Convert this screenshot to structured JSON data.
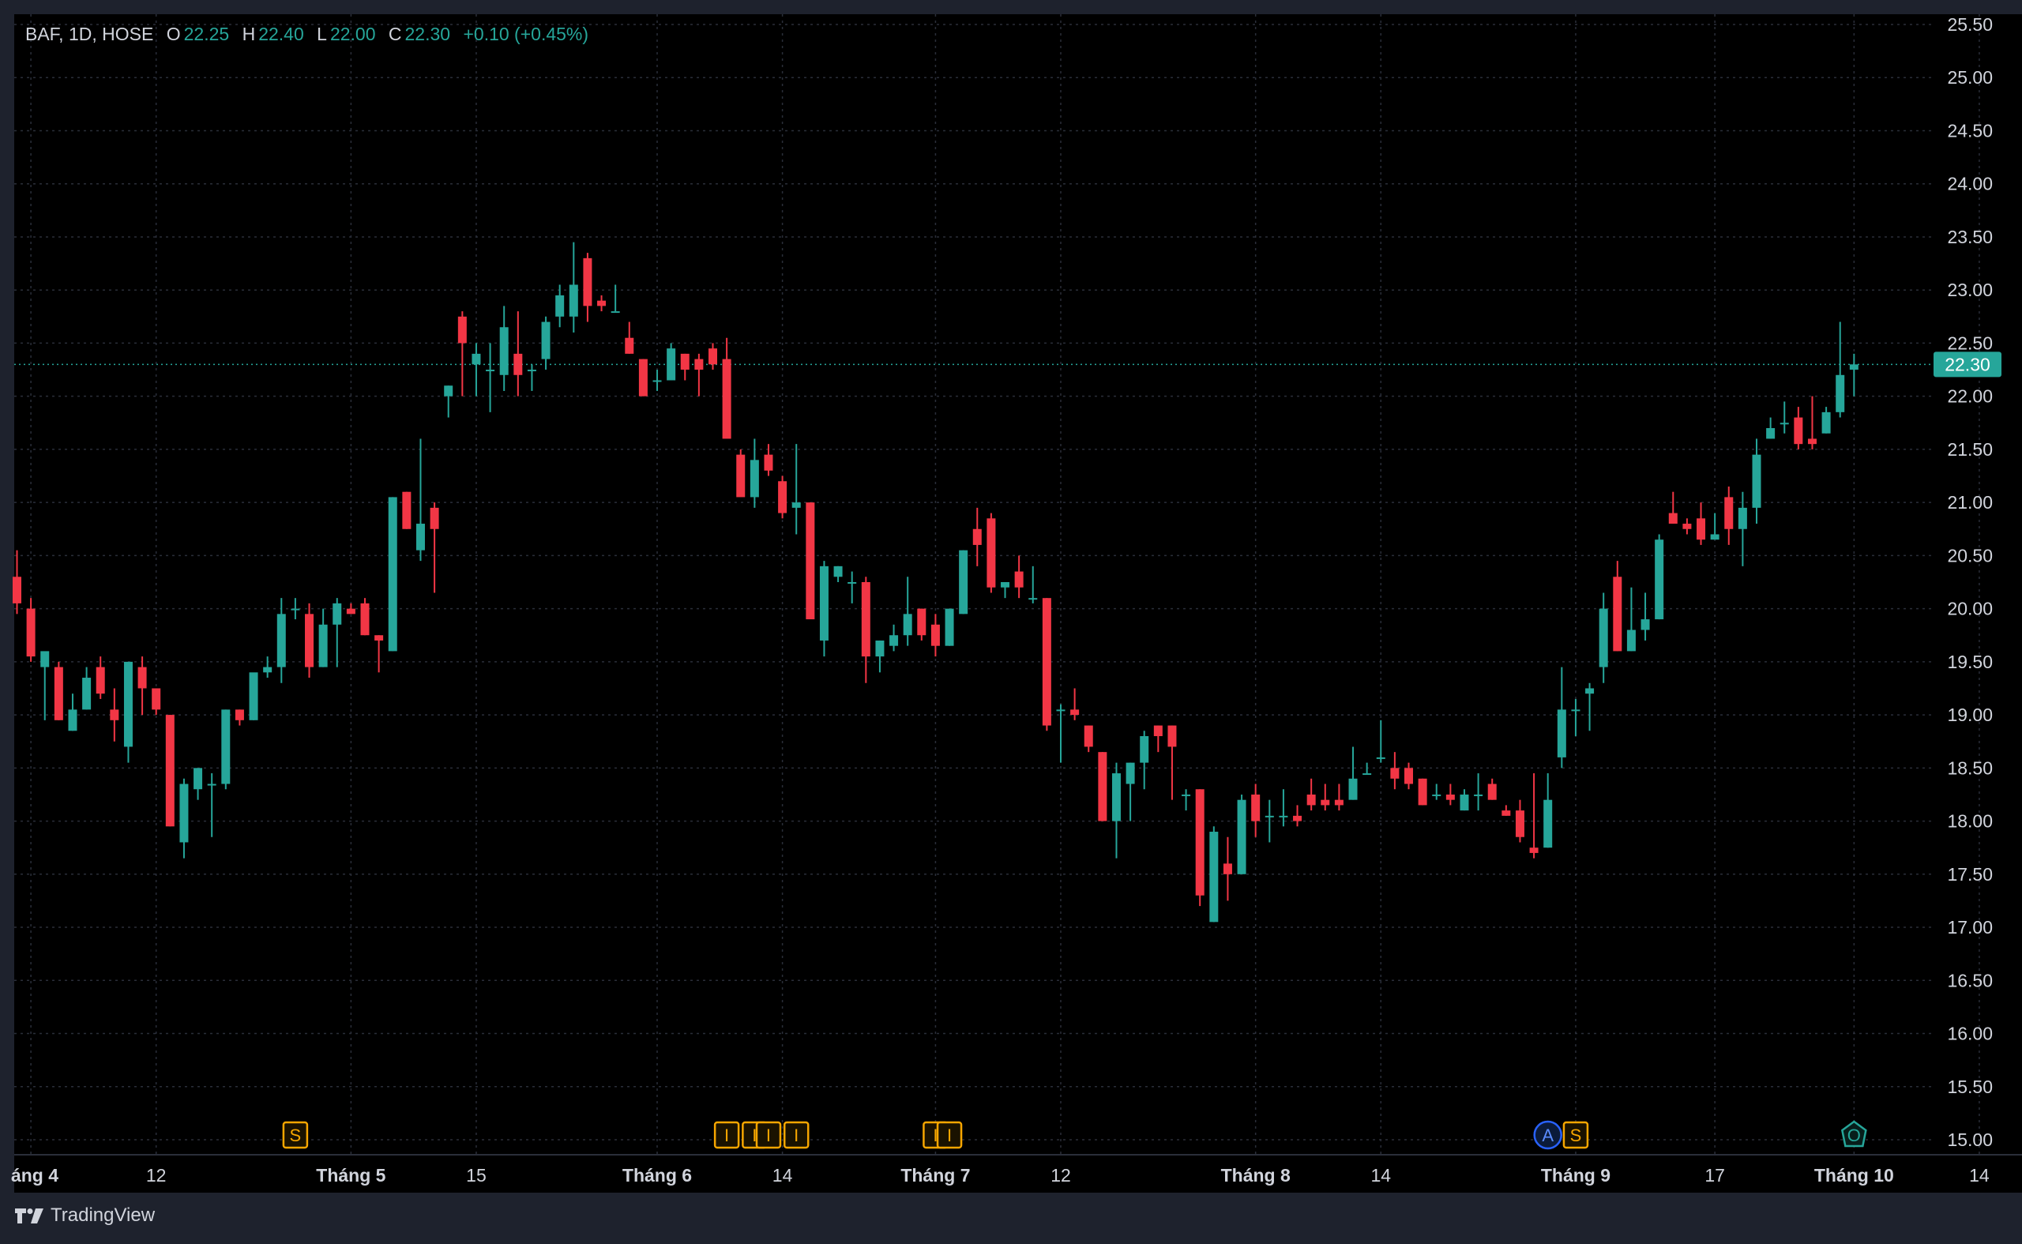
{
  "legend": {
    "symbol": "BAF, 1D, HOSE",
    "open_label": "O",
    "open": "22.25",
    "high_label": "H",
    "high": "22.40",
    "low_label": "L",
    "low": "22.00",
    "close_label": "C",
    "close": "22.30",
    "change": "+0.10 (+0.45%)"
  },
  "branding": {
    "name": "TradingView"
  },
  "colors": {
    "up": "#26a69a",
    "down": "#f23645",
    "marker": "#f7a600",
    "dividend": "#2962ff",
    "earnings": "#26a69a"
  },
  "markers": [
    {
      "label": "S",
      "type": "split",
      "date": "2024-04-26"
    },
    {
      "label": "I",
      "type": "ipo-event",
      "date": "2024-06-10"
    },
    {
      "label": "I",
      "type": "ipo-event",
      "date": "2024-06-12"
    },
    {
      "label": "I",
      "type": "ipo-event",
      "date": "2024-06-13"
    },
    {
      "label": "I",
      "type": "ipo-event",
      "date": "2024-06-17"
    },
    {
      "label": "I",
      "type": "ipo-event",
      "date": "2024-07-01"
    },
    {
      "label": "I",
      "type": "ipo-event",
      "date": "2024-07-02"
    },
    {
      "label": "A",
      "type": "dividend",
      "date": "2024-08-30"
    },
    {
      "label": "S",
      "type": "split",
      "date": "2024-09-03"
    },
    {
      "label": "O",
      "type": "earnings",
      "date": "2024-10-01"
    }
  ],
  "chart_data": {
    "type": "candlestick",
    "symbol": "BAF",
    "interval": "1D",
    "exchange": "HOSE",
    "y_range": [
      15.0,
      25.5
    ],
    "y_ticks": [
      "15.00",
      "15.50",
      "16.00",
      "16.50",
      "17.00",
      "17.50",
      "18.00",
      "18.50",
      "19.00",
      "19.50",
      "20.00",
      "20.50",
      "21.00",
      "21.50",
      "22.00",
      "22.50",
      "23.00",
      "23.50",
      "24.00",
      "24.50",
      "25.00",
      "25.50"
    ],
    "last_price": "22.30",
    "x_ticks": [
      {
        "label": "áng 4",
        "date": "2024-04-01"
      },
      {
        "label": "12",
        "date": "2024-04-12"
      },
      {
        "label": "Tháng 5",
        "date": "2024-05-02"
      },
      {
        "label": "15",
        "date": "2024-05-15"
      },
      {
        "label": "Tháng 6",
        "date": "2024-06-03"
      },
      {
        "label": "14",
        "date": "2024-06-14"
      },
      {
        "label": "Tháng 7",
        "date": "2024-07-01"
      },
      {
        "label": "12",
        "date": "2024-07-12"
      },
      {
        "label": "Tháng 8",
        "date": "2024-08-01"
      },
      {
        "label": "14",
        "date": "2024-08-14"
      },
      {
        "label": "Tháng 9",
        "date": "2024-09-03"
      },
      {
        "label": "17",
        "date": "2024-09-17"
      },
      {
        "label": "Tháng 10",
        "date": "2024-10-01"
      },
      {
        "label": "14",
        "date": "2024-10-14"
      }
    ],
    "grid": true,
    "candles": [
      {
        "o": 20.3,
        "h": 20.55,
        "l": 19.95,
        "c": 20.05
      },
      {
        "o": 20.0,
        "h": 20.1,
        "l": 19.5,
        "c": 19.55
      },
      {
        "o": 19.45,
        "h": 19.55,
        "l": 18.95,
        "c": 19.6
      },
      {
        "o": 19.45,
        "h": 19.5,
        "l": 18.95,
        "c": 18.95
      },
      {
        "o": 18.85,
        "h": 19.2,
        "l": 18.85,
        "c": 19.05
      },
      {
        "o": 19.05,
        "h": 19.45,
        "l": 19.05,
        "c": 19.35
      },
      {
        "o": 19.45,
        "h": 19.55,
        "l": 19.15,
        "c": 19.2
      },
      {
        "o": 19.05,
        "h": 19.25,
        "l": 18.75,
        "c": 18.95
      },
      {
        "o": 18.7,
        "h": 19.5,
        "l": 18.55,
        "c": 19.5
      },
      {
        "o": 19.45,
        "h": 19.55,
        "l": 19.0,
        "c": 19.25
      },
      {
        "o": 19.25,
        "h": 19.25,
        "l": 19.0,
        "c": 19.05
      },
      {
        "o": 19.0,
        "h": 19.0,
        "l": 17.95,
        "c": 17.95
      },
      {
        "o": 17.8,
        "h": 18.4,
        "l": 17.65,
        "c": 18.35
      },
      {
        "o": 18.3,
        "h": 18.5,
        "l": 18.2,
        "c": 18.5
      },
      {
        "o": 18.35,
        "h": 18.45,
        "l": 17.85,
        "c": 18.35
      },
      {
        "o": 18.35,
        "h": 19.05,
        "l": 18.3,
        "c": 19.05
      },
      {
        "o": 19.05,
        "h": 19.05,
        "l": 18.9,
        "c": 18.95
      },
      {
        "o": 18.95,
        "h": 19.35,
        "l": 18.95,
        "c": 19.4
      },
      {
        "o": 19.4,
        "h": 19.55,
        "l": 19.35,
        "c": 19.45
      },
      {
        "o": 19.45,
        "h": 20.1,
        "l": 19.3,
        "c": 19.95
      },
      {
        "o": 20.0,
        "h": 20.1,
        "l": 19.9,
        "c": 20.0
      },
      {
        "o": 19.95,
        "h": 20.05,
        "l": 19.35,
        "c": 19.45
      },
      {
        "o": 19.45,
        "h": 20.0,
        "l": 19.45,
        "c": 19.85
      },
      {
        "o": 19.85,
        "h": 20.1,
        "l": 19.45,
        "c": 20.05
      },
      {
        "o": 20.0,
        "h": 20.05,
        "l": 19.95,
        "c": 19.95
      },
      {
        "o": 20.05,
        "h": 20.1,
        "l": 19.75,
        "c": 19.75
      },
      {
        "o": 19.75,
        "h": 19.75,
        "l": 19.4,
        "c": 19.7
      },
      {
        "o": 19.6,
        "h": 21.05,
        "l": 19.6,
        "c": 21.05
      },
      {
        "o": 21.1,
        "h": 21.1,
        "l": 20.75,
        "c": 20.75
      },
      {
        "o": 20.55,
        "h": 21.6,
        "l": 20.45,
        "c": 20.8
      },
      {
        "o": 20.95,
        "h": 21.0,
        "l": 20.15,
        "c": 20.75
      },
      {
        "o": 22.0,
        "h": 22.1,
        "l": 21.8,
        "c": 22.1
      },
      {
        "o": 22.75,
        "h": 22.8,
        "l": 22.0,
        "c": 22.5
      },
      {
        "o": 22.3,
        "h": 22.5,
        "l": 22.0,
        "c": 22.4
      },
      {
        "o": 22.25,
        "h": 22.5,
        "l": 21.85,
        "c": 22.25
      },
      {
        "o": 22.2,
        "h": 22.85,
        "l": 22.05,
        "c": 22.65
      },
      {
        "o": 22.4,
        "h": 22.8,
        "l": 22.0,
        "c": 22.2
      },
      {
        "o": 22.25,
        "h": 22.3,
        "l": 22.05,
        "c": 22.25
      },
      {
        "o": 22.35,
        "h": 22.75,
        "l": 22.25,
        "c": 22.7
      },
      {
        "o": 22.75,
        "h": 23.05,
        "l": 22.65,
        "c": 22.95
      },
      {
        "o": 22.75,
        "h": 23.45,
        "l": 22.6,
        "c": 23.05
      },
      {
        "o": 23.3,
        "h": 23.35,
        "l": 22.7,
        "c": 22.85
      },
      {
        "o": 22.9,
        "h": 22.95,
        "l": 22.8,
        "c": 22.85
      },
      {
        "o": 22.8,
        "h": 23.05,
        "l": 22.8,
        "c": 22.8
      },
      {
        "o": 22.55,
        "h": 22.7,
        "l": 22.4,
        "c": 22.4
      },
      {
        "o": 22.35,
        "h": 22.35,
        "l": 22.0,
        "c": 22.0
      },
      {
        "o": 22.15,
        "h": 22.25,
        "l": 22.05,
        "c": 22.15
      },
      {
        "o": 22.15,
        "h": 22.5,
        "l": 22.15,
        "c": 22.45
      },
      {
        "o": 22.4,
        "h": 22.4,
        "l": 22.15,
        "c": 22.25
      },
      {
        "o": 22.35,
        "h": 22.4,
        "l": 22.0,
        "c": 22.25
      },
      {
        "o": 22.45,
        "h": 22.5,
        "l": 22.25,
        "c": 22.3
      },
      {
        "o": 22.35,
        "h": 22.55,
        "l": 21.75,
        "c": 21.6
      },
      {
        "o": 21.45,
        "h": 21.5,
        "l": 21.1,
        "c": 21.05
      },
      {
        "o": 21.05,
        "h": 21.6,
        "l": 20.95,
        "c": 21.4
      },
      {
        "o": 21.45,
        "h": 21.55,
        "l": 21.25,
        "c": 21.3
      },
      {
        "o": 21.2,
        "h": 21.25,
        "l": 20.85,
        "c": 20.9
      },
      {
        "o": 20.95,
        "h": 21.55,
        "l": 20.7,
        "c": 21.0
      },
      {
        "o": 21.0,
        "h": 21.0,
        "l": 19.95,
        "c": 19.9
      },
      {
        "o": 19.7,
        "h": 20.45,
        "l": 19.55,
        "c": 20.4
      },
      {
        "o": 20.3,
        "h": 20.4,
        "l": 20.25,
        "c": 20.4
      },
      {
        "o": 20.25,
        "h": 20.35,
        "l": 20.05,
        "c": 20.25
      },
      {
        "o": 20.25,
        "h": 20.3,
        "l": 19.3,
        "c": 19.55
      },
      {
        "o": 19.55,
        "h": 19.7,
        "l": 19.4,
        "c": 19.7
      },
      {
        "o": 19.65,
        "h": 19.85,
        "l": 19.6,
        "c": 19.75
      },
      {
        "o": 19.75,
        "h": 20.3,
        "l": 19.65,
        "c": 19.95
      },
      {
        "o": 20.0,
        "h": 20.0,
        "l": 19.7,
        "c": 19.75
      },
      {
        "o": 19.85,
        "h": 19.95,
        "l": 19.55,
        "c": 19.65
      },
      {
        "o": 19.65,
        "h": 20.0,
        "l": 19.65,
        "c": 20.0
      },
      {
        "o": 19.95,
        "h": 20.55,
        "l": 19.95,
        "c": 20.55
      },
      {
        "o": 20.75,
        "h": 20.95,
        "l": 20.4,
        "c": 20.6
      },
      {
        "o": 20.85,
        "h": 20.9,
        "l": 20.15,
        "c": 20.2
      },
      {
        "o": 20.2,
        "h": 20.25,
        "l": 20.1,
        "c": 20.25
      },
      {
        "o": 20.35,
        "h": 20.5,
        "l": 20.1,
        "c": 20.2
      },
      {
        "o": 20.1,
        "h": 20.4,
        "l": 20.05,
        "c": 20.1
      },
      {
        "o": 20.1,
        "h": 20.1,
        "l": 18.85,
        "c": 18.9
      },
      {
        "o": 19.05,
        "h": 19.1,
        "l": 18.55,
        "c": 19.05
      },
      {
        "o": 19.05,
        "h": 19.25,
        "l": 18.95,
        "c": 19.0
      },
      {
        "o": 18.9,
        "h": 18.9,
        "l": 18.65,
        "c": 18.7
      },
      {
        "o": 18.65,
        "h": 18.65,
        "l": 18.0,
        "c": 18.0
      },
      {
        "o": 18.0,
        "h": 18.55,
        "l": 17.65,
        "c": 18.45
      },
      {
        "o": 18.35,
        "h": 18.55,
        "l": 18.0,
        "c": 18.55
      },
      {
        "o": 18.55,
        "h": 18.85,
        "l": 18.3,
        "c": 18.8
      },
      {
        "o": 18.9,
        "h": 18.9,
        "l": 18.65,
        "c": 18.8
      },
      {
        "o": 18.9,
        "h": 18.9,
        "l": 18.2,
        "c": 18.7
      },
      {
        "o": 18.25,
        "h": 18.3,
        "l": 18.1,
        "c": 18.25
      },
      {
        "o": 18.3,
        "h": 18.3,
        "l": 17.2,
        "c": 17.3
      },
      {
        "o": 17.05,
        "h": 17.95,
        "l": 17.05,
        "c": 17.9
      },
      {
        "o": 17.6,
        "h": 17.85,
        "l": 17.25,
        "c": 17.5
      },
      {
        "o": 17.5,
        "h": 18.25,
        "l": 17.5,
        "c": 18.2
      },
      {
        "o": 18.25,
        "h": 18.35,
        "l": 17.85,
        "c": 18.0
      },
      {
        "o": 18.05,
        "h": 18.2,
        "l": 17.8,
        "c": 18.05
      },
      {
        "o": 18.05,
        "h": 18.3,
        "l": 17.95,
        "c": 18.05
      },
      {
        "o": 18.05,
        "h": 18.15,
        "l": 17.95,
        "c": 18.0
      },
      {
        "o": 18.25,
        "h": 18.4,
        "l": 18.1,
        "c": 18.15
      },
      {
        "o": 18.2,
        "h": 18.35,
        "l": 18.1,
        "c": 18.15
      },
      {
        "o": 18.2,
        "h": 18.35,
        "l": 18.1,
        "c": 18.15
      },
      {
        "o": 18.2,
        "h": 18.7,
        "l": 18.2,
        "c": 18.4
      },
      {
        "o": 18.45,
        "h": 18.55,
        "l": 18.45,
        "c": 18.45
      },
      {
        "o": 18.6,
        "h": 18.95,
        "l": 18.55,
        "c": 18.6
      },
      {
        "o": 18.5,
        "h": 18.65,
        "l": 18.3,
        "c": 18.4
      },
      {
        "o": 18.5,
        "h": 18.55,
        "l": 18.3,
        "c": 18.35
      },
      {
        "o": 18.4,
        "h": 18.4,
        "l": 18.15,
        "c": 18.15
      },
      {
        "o": 18.25,
        "h": 18.35,
        "l": 18.2,
        "c": 18.25
      },
      {
        "o": 18.25,
        "h": 18.35,
        "l": 18.15,
        "c": 18.2
      },
      {
        "o": 18.1,
        "h": 18.3,
        "l": 18.1,
        "c": 18.25
      },
      {
        "o": 18.25,
        "h": 18.45,
        "l": 18.1,
        "c": 18.25
      },
      {
        "o": 18.35,
        "h": 18.4,
        "l": 18.2,
        "c": 18.2
      },
      {
        "o": 18.1,
        "h": 18.15,
        "l": 18.05,
        "c": 18.05
      },
      {
        "o": 18.1,
        "h": 18.2,
        "l": 17.8,
        "c": 17.85
      },
      {
        "o": 17.75,
        "h": 18.45,
        "l": 17.65,
        "c": 17.7
      },
      {
        "o": 17.75,
        "h": 18.45,
        "l": 17.75,
        "c": 18.2
      },
      {
        "o": 18.6,
        "h": 19.45,
        "l": 18.5,
        "c": 19.05
      },
      {
        "o": 19.05,
        "h": 19.15,
        "l": 18.8,
        "c": 19.05
      },
      {
        "o": 19.2,
        "h": 19.3,
        "l": 18.85,
        "c": 19.25
      },
      {
        "o": 19.45,
        "h": 20.15,
        "l": 19.3,
        "c": 20.0
      },
      {
        "o": 20.3,
        "h": 20.45,
        "l": 19.6,
        "c": 19.6
      },
      {
        "o": 19.6,
        "h": 20.2,
        "l": 19.6,
        "c": 19.8
      },
      {
        "o": 19.8,
        "h": 20.15,
        "l": 19.7,
        "c": 19.9
      },
      {
        "o": 19.9,
        "h": 20.7,
        "l": 19.9,
        "c": 20.65
      },
      {
        "o": 20.9,
        "h": 21.1,
        "l": 20.8,
        "c": 20.8
      },
      {
        "o": 20.8,
        "h": 20.85,
        "l": 20.7,
        "c": 20.75
      },
      {
        "o": 20.85,
        "h": 21.0,
        "l": 20.6,
        "c": 20.65
      },
      {
        "o": 20.65,
        "h": 20.9,
        "l": 20.65,
        "c": 20.7
      },
      {
        "o": 21.05,
        "h": 21.15,
        "l": 20.6,
        "c": 20.75
      },
      {
        "o": 20.75,
        "h": 21.1,
        "l": 20.4,
        "c": 20.95
      },
      {
        "o": 20.95,
        "h": 21.6,
        "l": 20.8,
        "c": 21.45
      },
      {
        "o": 21.6,
        "h": 21.8,
        "l": 21.6,
        "c": 21.7
      },
      {
        "o": 21.75,
        "h": 21.95,
        "l": 21.65,
        "c": 21.75
      },
      {
        "o": 21.8,
        "h": 21.9,
        "l": 21.5,
        "c": 21.55
      },
      {
        "o": 21.6,
        "h": 22.0,
        "l": 21.5,
        "c": 21.55
      },
      {
        "o": 21.65,
        "h": 21.9,
        "l": 21.65,
        "c": 21.85
      },
      {
        "o": 21.85,
        "h": 22.7,
        "l": 21.8,
        "c": 22.2
      },
      {
        "o": 22.25,
        "h": 22.4,
        "l": 22.0,
        "c": 22.3
      }
    ]
  }
}
